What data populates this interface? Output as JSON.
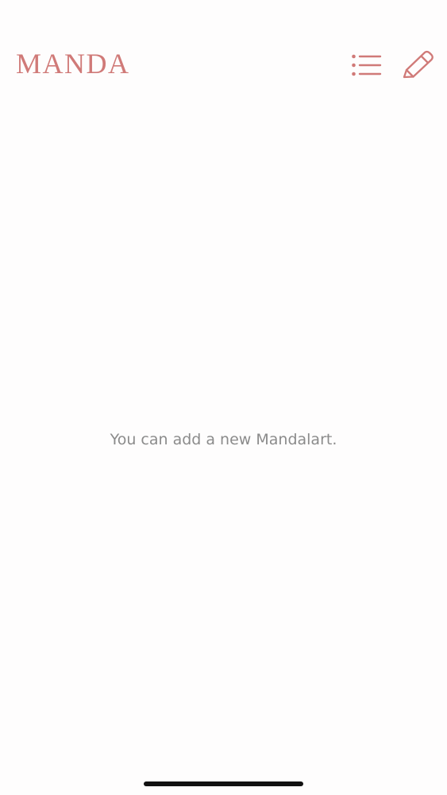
{
  "header": {
    "title": "MANDA",
    "list_icon": "list-icon",
    "edit_icon": "pencil-icon"
  },
  "main": {
    "empty_message": "You can add a new Mandalart."
  },
  "colors": {
    "accent": "#d07a78",
    "message_text": "#8b8b8b",
    "background": "#fefdfd",
    "home_indicator": "#111111"
  }
}
